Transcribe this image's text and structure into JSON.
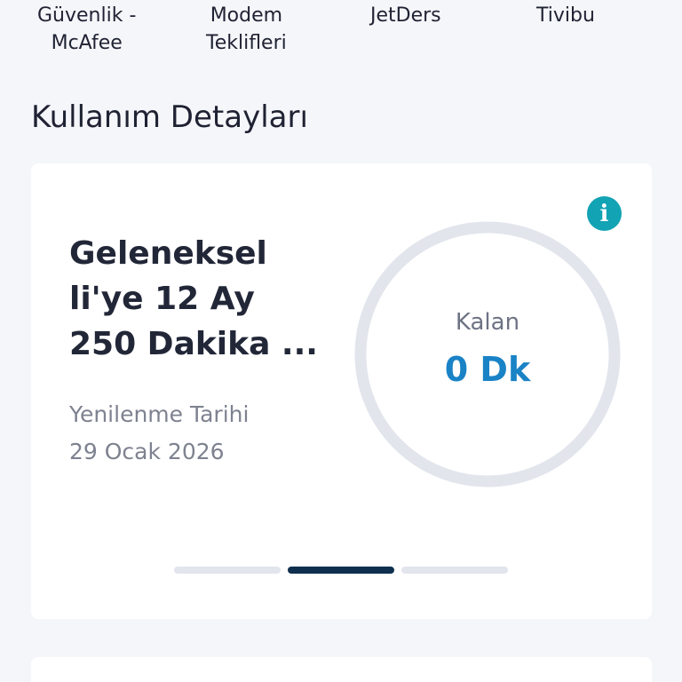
{
  "top_nav": {
    "items": [
      {
        "label": "Güvenlik -\nMcAfee"
      },
      {
        "label": "Modem\nTeklifleri"
      },
      {
        "label": "JetDers"
      },
      {
        "label": "Tivibu"
      }
    ]
  },
  "section": {
    "title": "Kullanım Detayları"
  },
  "card": {
    "plan_name": "Geleneksel\nli'ye 12 Ay\n250 Dakika ...",
    "renew_label": "Yenilenme Tarihi",
    "renew_date": "29 Ocak 2026",
    "info_icon": "info-icon",
    "remaining_label": "Kalan",
    "remaining_value": "0 Dk",
    "pager": {
      "count": 3,
      "active_index": 1
    }
  },
  "colors": {
    "accent": "#1a83c6",
    "info": "#12a3b4",
    "ring": "#e2e5ec",
    "pager_active": "#0f2f4e"
  }
}
